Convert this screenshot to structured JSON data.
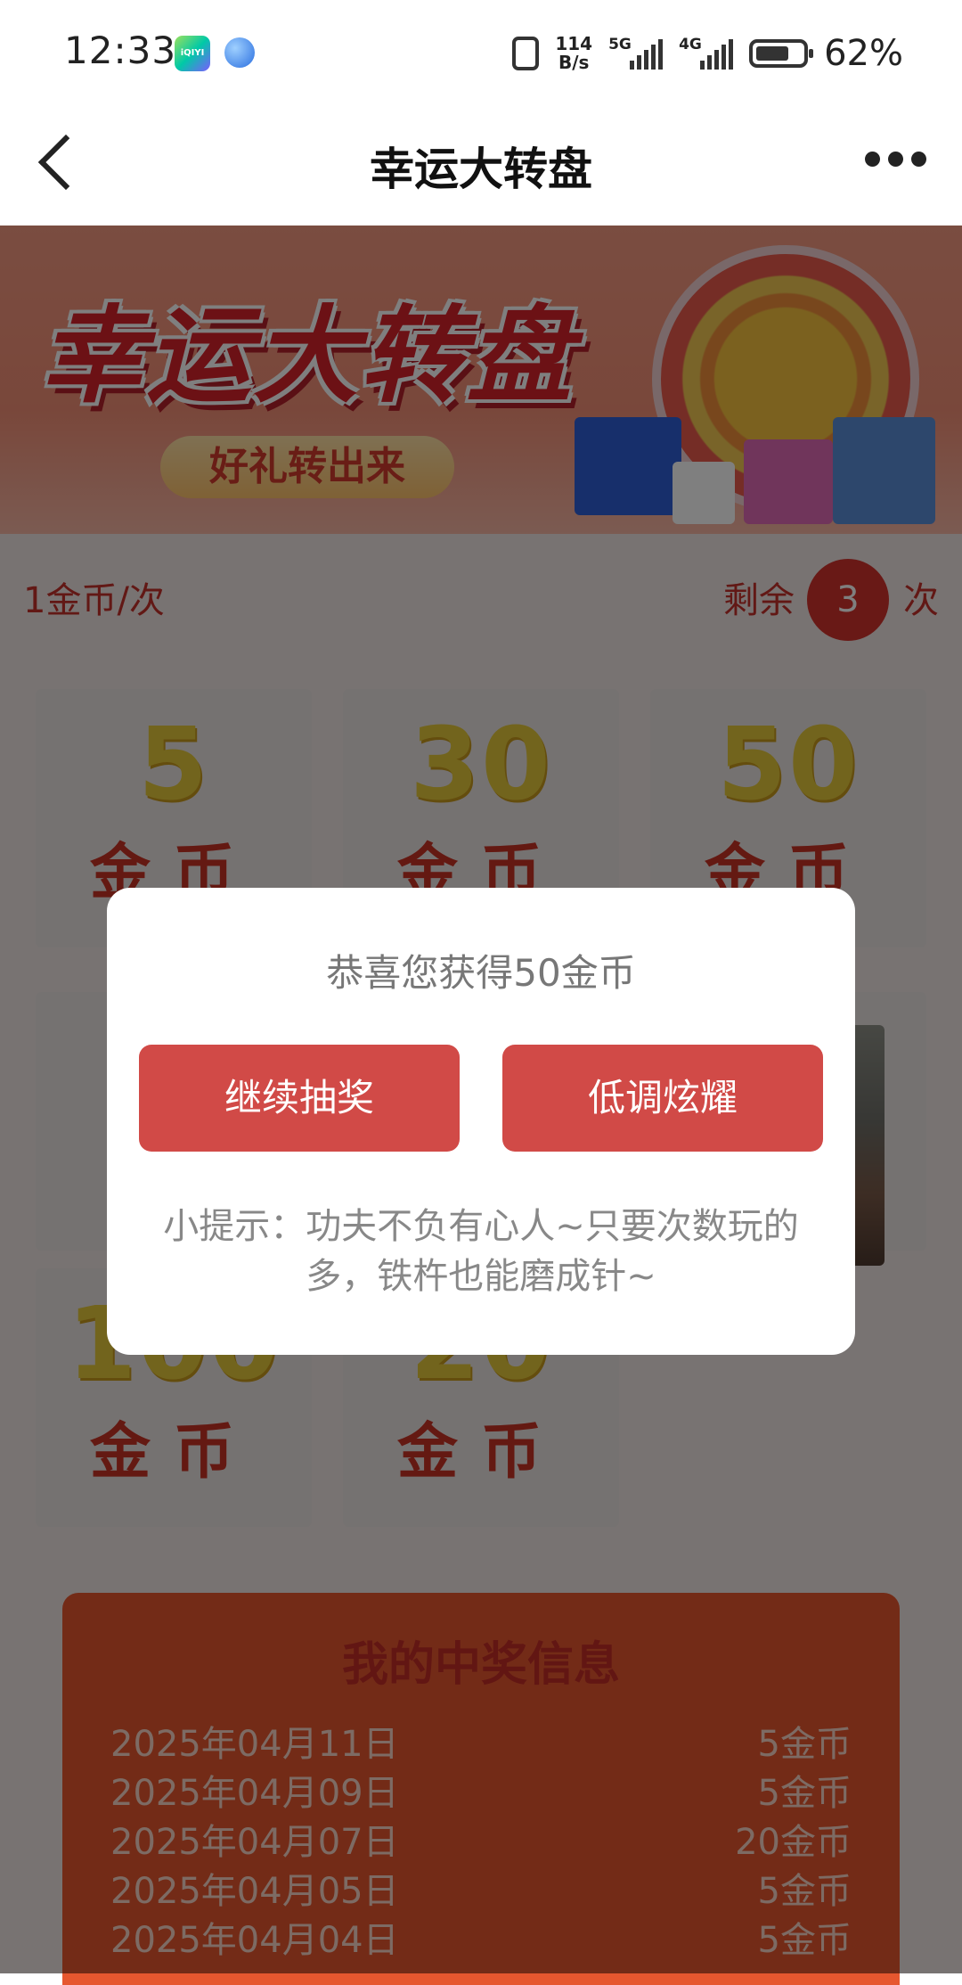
{
  "status_bar": {
    "time": "12:33",
    "iqiyi_icon": "iQIYI",
    "net_speed_top": "114",
    "net_speed_bottom": "B/s",
    "signal_1": "5G",
    "signal_2": "4G",
    "battery": "62%"
  },
  "nav": {
    "title": "幸运大转盘"
  },
  "banner": {
    "title": "幸运大转盘",
    "subtitle": "好礼转出来"
  },
  "cost": {
    "per_spin": "1金币/次",
    "remaining_label": "剩余",
    "remaining_count": "3",
    "remaining_unit": "次"
  },
  "prizes": [
    {
      "value": "5",
      "unit": "金币"
    },
    {
      "value": "30",
      "unit": "金币"
    },
    {
      "value": "50",
      "unit": "金币"
    },
    {
      "value": "100",
      "unit": "金币"
    },
    {
      "value": "20",
      "unit": "金币"
    }
  ],
  "winning": {
    "title": "我的中奖信息",
    "records": [
      {
        "date": "2025年04月11日",
        "prize": "5金币"
      },
      {
        "date": "2025年04月09日",
        "prize": "5金币"
      },
      {
        "date": "2025年04月07日",
        "prize": "20金币"
      },
      {
        "date": "2025年04月05日",
        "prize": "5金币"
      },
      {
        "date": "2025年04月04日",
        "prize": "5金币"
      }
    ]
  },
  "modal": {
    "message": "恭喜您获得50金币",
    "continue_label": "继续抽奖",
    "showoff_label": "低调炫耀",
    "tip": "小提示：功夫不负有心人~只要次数玩的多，铁杵也能磨成针~"
  },
  "colors": {
    "accent_red": "#d14a47",
    "gold": "#e5c93a",
    "banner_bg": "#f38f76"
  }
}
